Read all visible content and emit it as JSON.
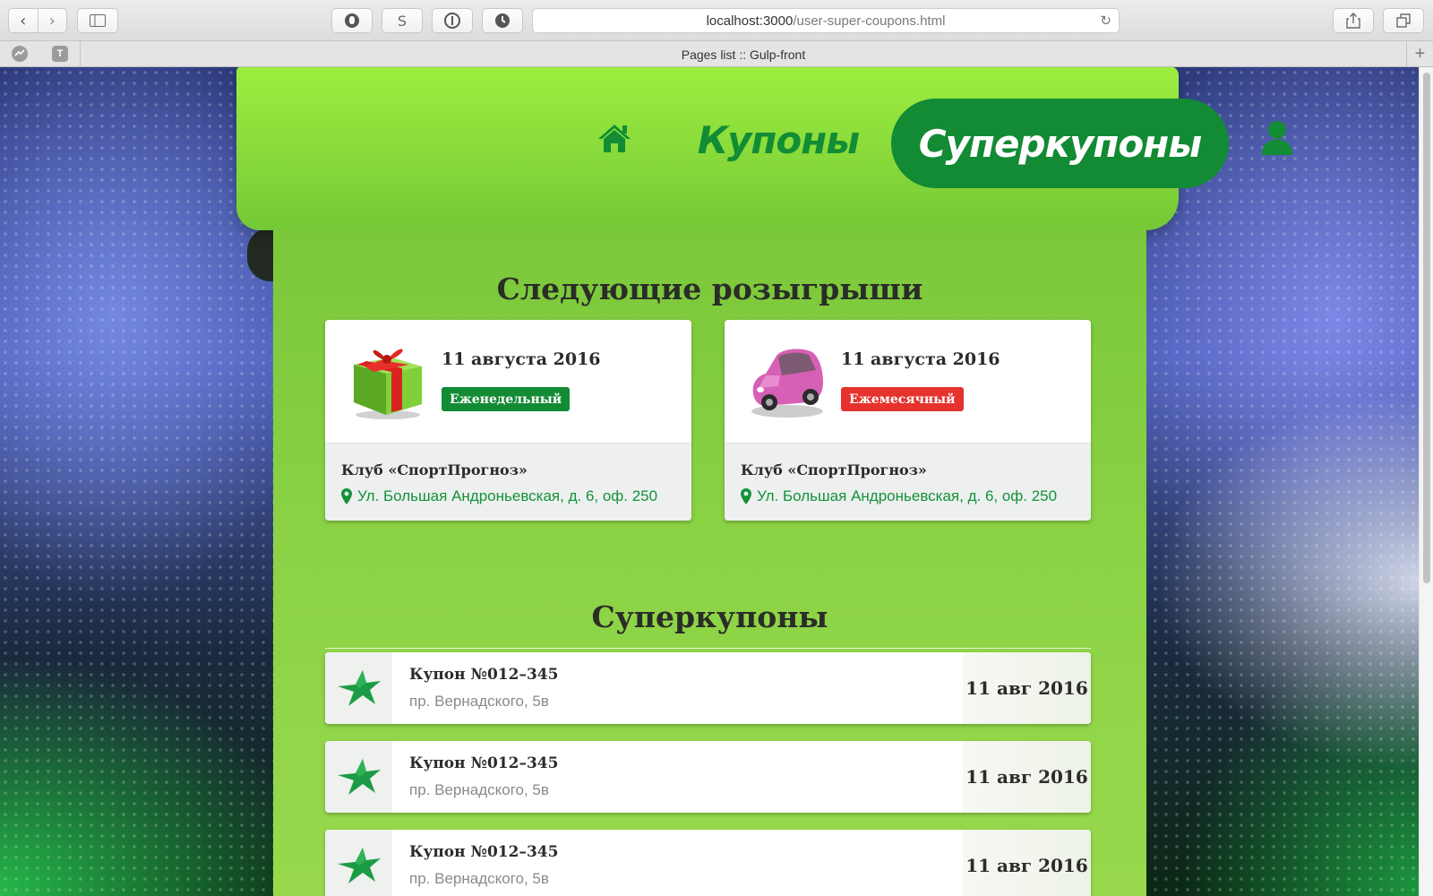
{
  "browser": {
    "url_host": "localhost:3000",
    "url_path": "/user-super-coupons.html",
    "tab_title": "Pages list :: Gulp-front",
    "toolbar_icons": [
      "back-icon",
      "forward-icon",
      "sidebar-icon",
      "ghostery-icon",
      "s-extension-icon",
      "1password-icon",
      "history-icon",
      "share-icon",
      "tabs-icon"
    ],
    "extension_s_label": "S",
    "pinned_tab_label": "T"
  },
  "nav": {
    "coupons_label": "Купоны",
    "super_label": "Суперкупоны",
    "accent_color": "#138a34"
  },
  "draws": {
    "title": "Следующие розыгрыши",
    "cards": [
      {
        "image": "gift-box",
        "date": "11 августа 2016",
        "badge": "Еженедельный",
        "badge_color": "#138a34",
        "club": "Клуб «СпортПрогноз»",
        "address": "Ул. Большая Андроньевская, д. 6, оф. 250"
      },
      {
        "image": "pink-car",
        "date": "11 августа 2016",
        "badge": "Ежемесячный",
        "badge_color": "#e5322d",
        "club": "Клуб «СпортПрогноз»",
        "address": "Ул. Большая Андроньевская, д. 6, оф. 250"
      }
    ]
  },
  "supercoupons": {
    "title": "Суперкупоны",
    "items": [
      {
        "name": "Купон №012–345",
        "place": "пр. Вернадского, 5в",
        "date": "11 авг 2016"
      },
      {
        "name": "Купон №012–345",
        "place": "пр. Вернадского, 5в",
        "date": "11 авг 2016"
      },
      {
        "name": "Купон №012–345",
        "place": "пр. Вернадского, 5в",
        "date": "11 авг 2016"
      }
    ]
  }
}
